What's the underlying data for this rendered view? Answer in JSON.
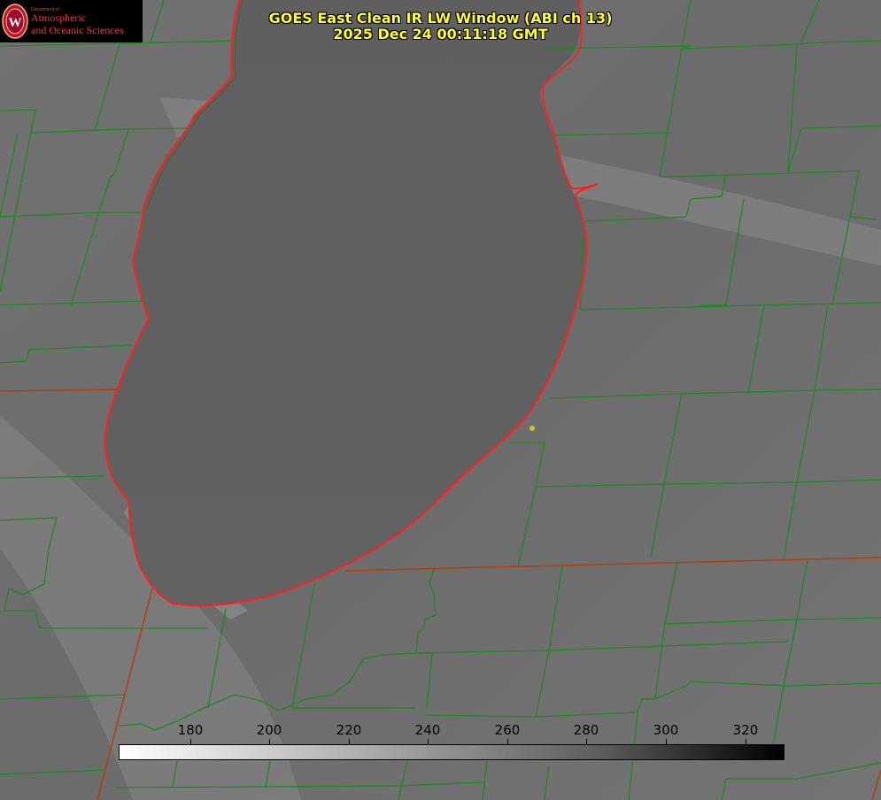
{
  "title": {
    "line1": "GOES East Clean IR LW Window (ABI ch 13)",
    "line2": "2025 Dec 24 00:11:18 GMT"
  },
  "logo": {
    "department": "Department of",
    "line1": "Atmospheric",
    "line2": "and Oceanic Sciences",
    "seal_letter": "W"
  },
  "colorbar": {
    "ticks": [
      "180",
      "200",
      "220",
      "240",
      "260",
      "280",
      "300",
      "320"
    ],
    "colors": [
      "#ffffff",
      "#000000"
    ]
  },
  "colors": {
    "county_lines": "#1e8a1e",
    "shoreline": "#ff2020",
    "state_lines": "#b04010",
    "marker": "#d6c020",
    "title": "#ffff33"
  }
}
